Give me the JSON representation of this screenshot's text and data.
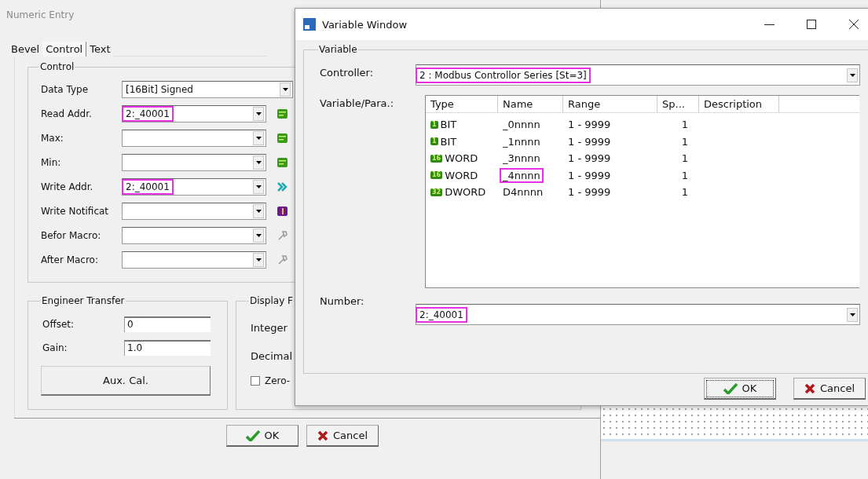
{
  "numeric_entry": {
    "title": "Numeric Entry",
    "tabs": [
      {
        "label": "Bevel",
        "selected": false
      },
      {
        "label": "Control",
        "selected": true
      },
      {
        "label": "Text",
        "selected": false
      }
    ],
    "control_group": {
      "legend": "Control",
      "rows": [
        {
          "label": "Data Type",
          "value": "[16Bit] Signed",
          "highlighted": false
        },
        {
          "label": "Read Addr.",
          "value": "2:_40001",
          "highlighted": true,
          "kind": "expression"
        },
        {
          "label": "Max:",
          "highlighted": false,
          "kind": "expression"
        },
        {
          "label": "Min:",
          "highlighted": false,
          "kind": "expression"
        },
        {
          "label": "Write Addr.",
          "value": "2:_40001",
          "highlighted": true,
          "kind": "link"
        },
        {
          "label": "Write Notificat",
          "highlighted": false,
          "kind": "notify"
        },
        {
          "label": "Befor Macro:",
          "highlighted": false,
          "kind": "macro"
        },
        {
          "label": "After Macro:",
          "highlighted": false,
          "kind": "macro"
        }
      ]
    },
    "engineer_transfer": {
      "legend": "Engineer Transfer",
      "fields": [
        {
          "label": "Offset:",
          "value": "0"
        },
        {
          "label": "Gain:",
          "value": "1.0"
        }
      ],
      "button": "Aux. Cal."
    },
    "display_format": {
      "legend": "Display F",
      "labels": [
        "Integer",
        "Decimal"
      ],
      "checkbox": {
        "label": "Zero-",
        "checked": false
      }
    },
    "buttons": [
      {
        "label": "OK"
      },
      {
        "label": "Cancel"
      }
    ]
  },
  "variable_window": {
    "title": "Variable Window",
    "legend": "Variable",
    "controller": {
      "label": "Controller:",
      "value": "2 : Modbus Controllor Series [St=3]",
      "highlighted": true
    },
    "list": {
      "label": "Variable/Para.:",
      "columns": [
        "Type",
        "Name",
        "Range",
        "Sp...",
        "Description"
      ],
      "rows": [
        {
          "badge": "1",
          "type": "BIT",
          "name": "_0nnnn",
          "range": "1 - 9999",
          "sp": "1",
          "highlighted": false
        },
        {
          "badge": "1",
          "type": "BIT",
          "name": "_1nnnn",
          "range": "1 - 9999",
          "sp": "1",
          "highlighted": false
        },
        {
          "badge": "16",
          "type": "WORD",
          "name": "_3nnnn",
          "range": "1 - 9999",
          "sp": "1",
          "highlighted": false
        },
        {
          "badge": "16",
          "type": "WORD",
          "name": "_4nnnn",
          "range": "1 - 9999",
          "sp": "1",
          "highlighted": true
        },
        {
          "badge": "32",
          "type": "DWORD",
          "name": "D4nnnn",
          "range": "1 - 9999",
          "sp": "1",
          "highlighted": false
        }
      ]
    },
    "number": {
      "label": "Number:",
      "value": "2:_40001",
      "highlighted": true
    },
    "buttons": [
      {
        "label": "OK",
        "focused": true
      },
      {
        "label": "Cancel",
        "focused": false
      }
    ]
  }
}
